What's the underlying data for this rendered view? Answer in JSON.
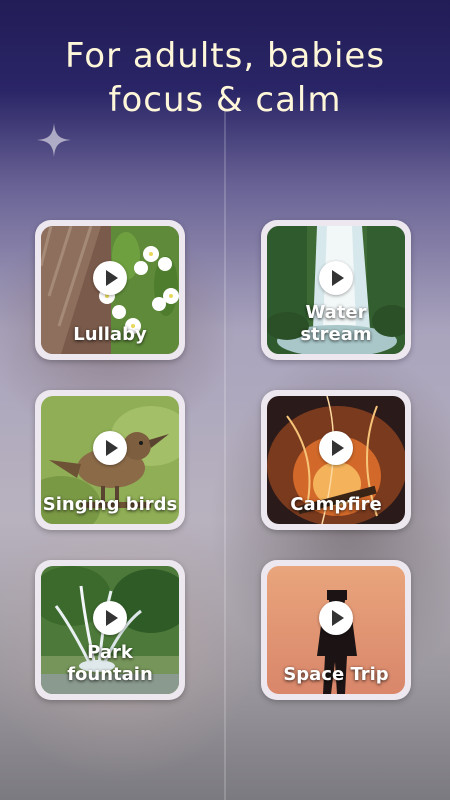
{
  "headline": {
    "line1": "For adults, babies",
    "line2": "focus & calm"
  },
  "colors": {
    "headline": "#fff7d9",
    "background_top": "#221d57",
    "card_frame": "#ede7ef",
    "play_button": "#ffffff"
  },
  "cards": [
    {
      "label": "Lullaby",
      "icon": "play-icon"
    },
    {
      "label": "Water\nstream",
      "icon": "play-icon"
    },
    {
      "label": "Singing birds",
      "icon": "play-icon"
    },
    {
      "label": "Campfire",
      "icon": "play-icon"
    },
    {
      "label": "Park\nfountain",
      "icon": "play-icon"
    },
    {
      "label": "Space Trip",
      "icon": "play-icon"
    }
  ]
}
